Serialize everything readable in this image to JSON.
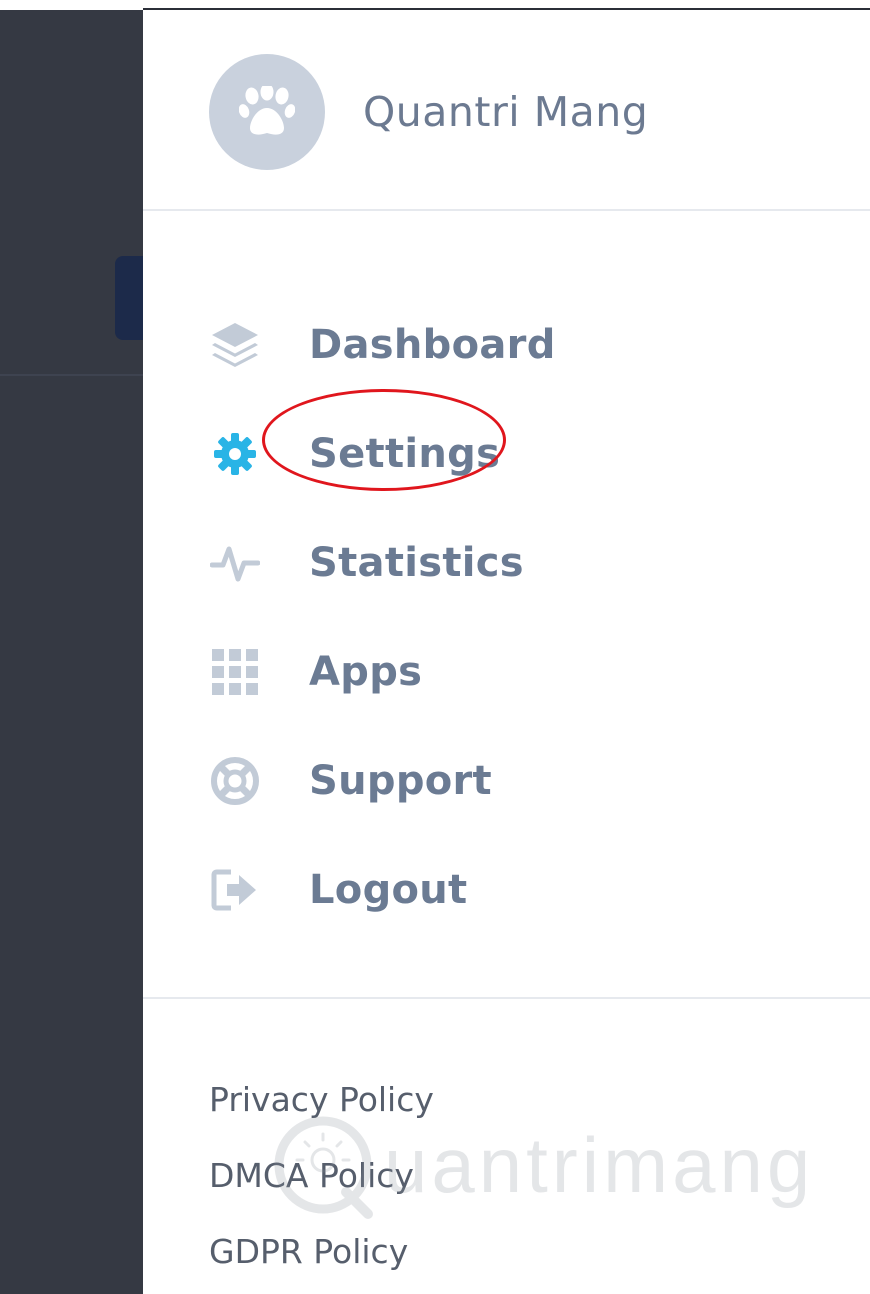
{
  "profile": {
    "name": "Quantri Mang",
    "avatar_icon": "paw-icon"
  },
  "menu": {
    "items": [
      {
        "label": "Dashboard",
        "icon": "layers-icon",
        "active": false
      },
      {
        "label": "Settings",
        "icon": "gear-icon",
        "active": true
      },
      {
        "label": "Statistics",
        "icon": "activity-icon",
        "active": false
      },
      {
        "label": "Apps",
        "icon": "grid-icon",
        "active": false
      },
      {
        "label": "Support",
        "icon": "lifebuoy-icon",
        "active": false
      },
      {
        "label": "Logout",
        "icon": "logout-icon",
        "active": false
      }
    ]
  },
  "footer": {
    "links": [
      "Privacy Policy",
      "DMCA Policy",
      "GDPR Policy"
    ]
  },
  "watermark": {
    "text": "uantrimang"
  },
  "colors": {
    "icon_muted": "#c2cbd7",
    "icon_active": "#29b4e6",
    "label": "#6b7b93",
    "highlight": "#e0161d",
    "backdrop": "#353943"
  }
}
